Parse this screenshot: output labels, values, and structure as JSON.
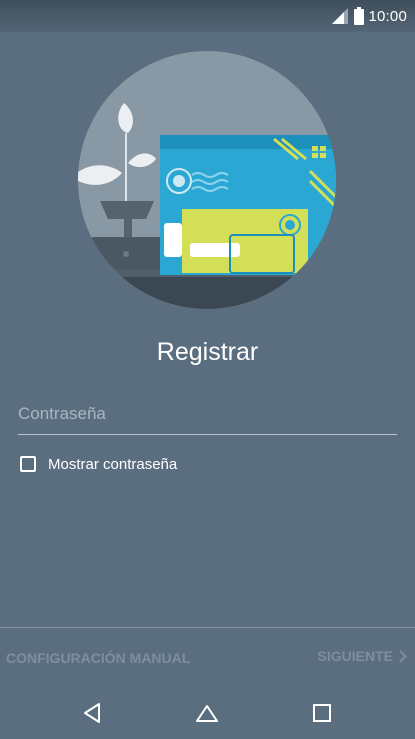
{
  "status_bar": {
    "time": "10:00",
    "icons": [
      "signal-icon",
      "battery-icon"
    ]
  },
  "hero": {
    "icon": "mail-illustration"
  },
  "title": "Registrar",
  "password": {
    "placeholder": "Contraseña",
    "value": ""
  },
  "show_password": {
    "label": "Mostrar contraseña",
    "checked": false
  },
  "actions": {
    "manual_label": "CONFIGURACIÓN MANUAL",
    "next_label": "SIGUIENTE"
  },
  "nav": {
    "icons": [
      "back-icon",
      "home-icon",
      "recents-icon"
    ]
  },
  "colors": {
    "background": "#5a6e7f",
    "text": "#ffffff",
    "disabled": "#7d8f9e"
  }
}
